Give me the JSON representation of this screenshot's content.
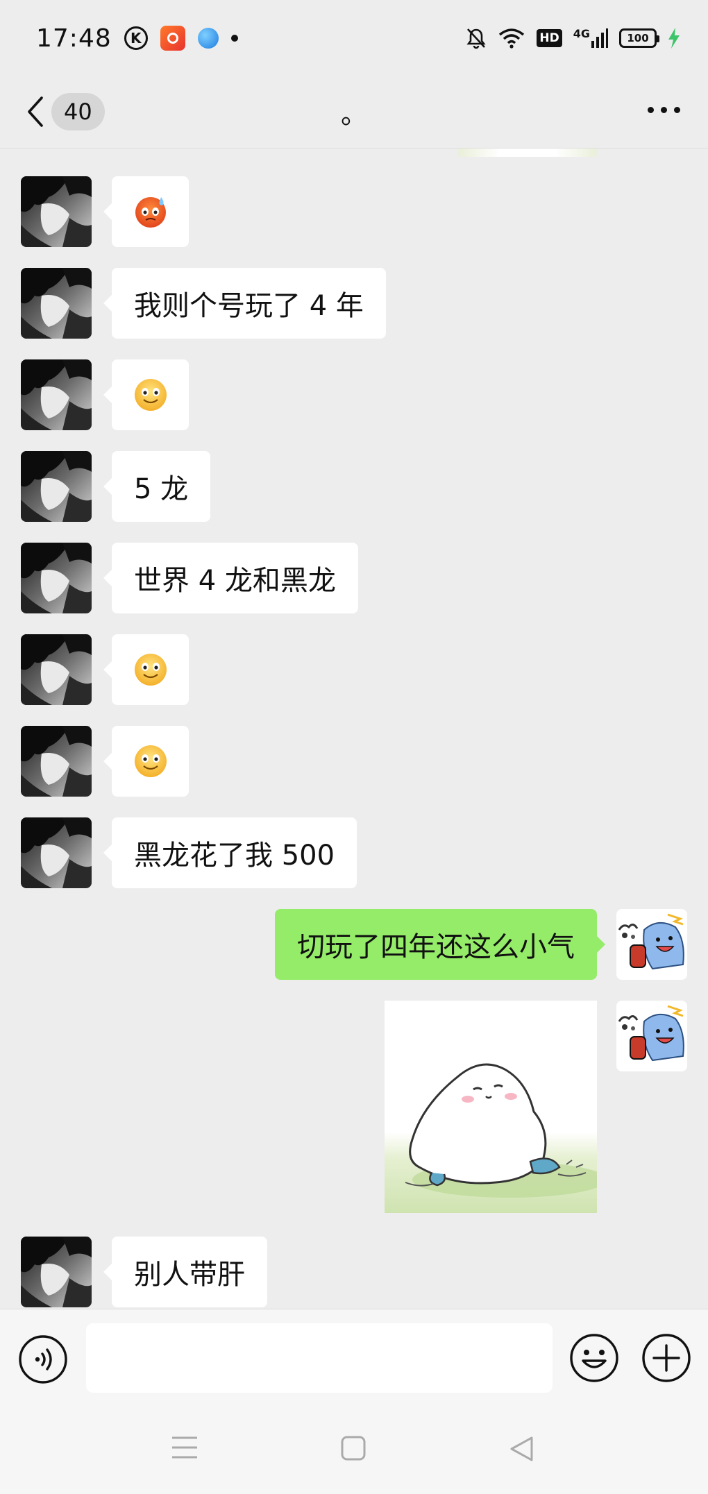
{
  "status_bar": {
    "time": "17:48",
    "k_icon_letter": "K",
    "network": "4G",
    "hd": "HD",
    "battery": "100"
  },
  "nav": {
    "unread_count": "40",
    "title": "。"
  },
  "messages": [
    {
      "sender": "other",
      "type": "emoji",
      "emoji": "sweat-emoji"
    },
    {
      "sender": "other",
      "type": "text",
      "text": "我则个号玩了 4 年"
    },
    {
      "sender": "other",
      "type": "emoji",
      "emoji": "smile-emoji"
    },
    {
      "sender": "other",
      "type": "text",
      "text": "5 龙"
    },
    {
      "sender": "other",
      "type": "text",
      "text": "世界 4 龙和黑龙"
    },
    {
      "sender": "other",
      "type": "emoji",
      "emoji": "smile-emoji"
    },
    {
      "sender": "other",
      "type": "emoji",
      "emoji": "smile-emoji"
    },
    {
      "sender": "other",
      "type": "text",
      "text": "黑龙花了我 500"
    },
    {
      "sender": "me",
      "type": "text",
      "text": "切玩了四年还这么小气"
    },
    {
      "sender": "me",
      "type": "sticker",
      "sticker": "lying-seal-sticker"
    },
    {
      "sender": "other",
      "type": "text",
      "text": "别人带肝"
    }
  ],
  "input": {
    "value": ""
  },
  "colors": {
    "background": "#ededed",
    "incoming_bubble": "#ffffff",
    "outgoing_bubble": "#95ec69",
    "charging_bolt": "#3cc46a"
  }
}
